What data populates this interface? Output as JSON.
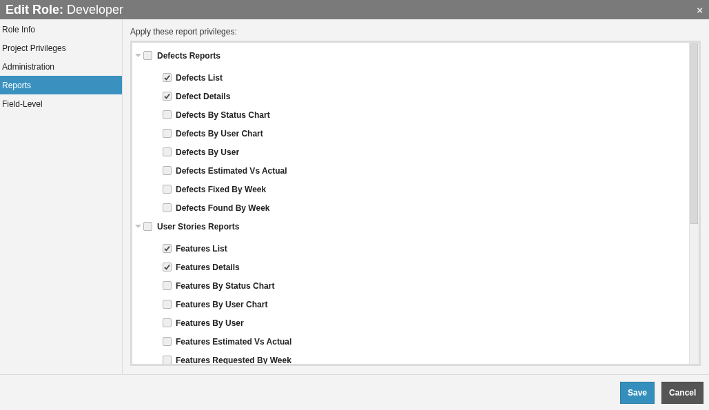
{
  "window": {
    "title": "**Edit Role:** Developer",
    "close": "×"
  },
  "sidebar": {
    "items": [
      {
        "label": "Role Info",
        "selected": false
      },
      {
        "label": "Project Privileges",
        "selected": false
      },
      {
        "label": "Administration",
        "selected": false
      },
      {
        "label": "Reports",
        "selected": true
      },
      {
        "label": "Field-Level",
        "selected": false
      }
    ]
  },
  "panel": {
    "heading": "Apply these report privileges:",
    "groups": [
      {
        "label": "Defects Reports",
        "checked": false,
        "expanded": true,
        "children": [
          {
            "label": "Defects List",
            "checked": true
          },
          {
            "label": "Defect Details",
            "checked": true
          },
          {
            "label": "Defects By Status Chart",
            "checked": false
          },
          {
            "label": "Defects By User Chart",
            "checked": false
          },
          {
            "label": "Defects By User",
            "checked": false
          },
          {
            "label": "Defects Estimated Vs Actual",
            "checked": false
          },
          {
            "label": "Defects Fixed By Week",
            "checked": false
          },
          {
            "label": "Defects Found By Week",
            "checked": false
          }
        ]
      },
      {
        "label": "User Stories Reports",
        "checked": false,
        "expanded": true,
        "children": [
          {
            "label": "Features List",
            "checked": true
          },
          {
            "label": "Features Details",
            "checked": true
          },
          {
            "label": "Features By Status Chart",
            "checked": false
          },
          {
            "label": "Features By User Chart",
            "checked": false
          },
          {
            "label": "Features By User",
            "checked": false
          },
          {
            "label": "Features Estimated Vs Actual",
            "checked": false
          },
          {
            "label": "Features Requested By Week",
            "checked": false
          }
        ]
      }
    ]
  },
  "buttons": [
    {
      "label": "Save",
      "kind": "primary"
    },
    {
      "label": "Cancel",
      "kind": "secondary"
    }
  ]
}
